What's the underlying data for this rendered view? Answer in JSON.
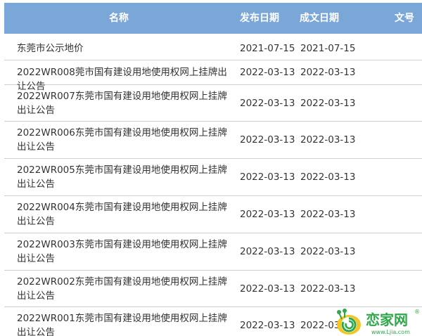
{
  "header": {
    "name": "名称",
    "publish_date": "发布日期",
    "written_date": "成文日期",
    "doc_no": "文号"
  },
  "rows": [
    {
      "name": "东莞市公示地价",
      "publish_date": "2021-07-15",
      "written_date": "2021-07-15"
    },
    {
      "name": "2022WR008莞市国有建设用地使用权网上挂牌出让公告",
      "publish_date": "2022-03-13",
      "written_date": "2022-03-13"
    },
    {
      "name": "2022WR007东莞市国有建设用地使用权网上挂牌出让公告",
      "publish_date": "2022-03-13",
      "written_date": "2022-03-13"
    },
    {
      "name": "2022WR006东莞市国有建设用地使用权网上挂牌出让公告",
      "publish_date": "2022-03-13",
      "written_date": "2022-03-13"
    },
    {
      "name": "2022WR005东莞市国有建设用地使用权网上挂牌出让公告",
      "publish_date": "2022-03-13",
      "written_date": "2022-03-13"
    },
    {
      "name": "2022WR004东莞市国有建设用地使用权网上挂牌出让公告",
      "publish_date": "2022-03-13",
      "written_date": "2022-03-13"
    },
    {
      "name": "2022WR003东莞市国有建设用地使用权网上挂牌出让公告",
      "publish_date": "2022-03-13",
      "written_date": "2022-03-13"
    },
    {
      "name": "2022WR002东莞市国有建设用地使用权网上挂牌出让公告",
      "publish_date": "2022-03-13",
      "written_date": "2022-03-13"
    },
    {
      "name": "2022WR001东莞市国有建设用地使用权网上挂牌出让公告",
      "publish_date": "2022-03-13",
      "written_date": "2022-03-1"
    }
  ],
  "watermark": {
    "logo_text": "恋家网",
    "url_text": "www.Ljia.com",
    "registered_mark": "®",
    "colors": {
      "green": "#2ea84a",
      "yellow": "#f3c623"
    }
  }
}
